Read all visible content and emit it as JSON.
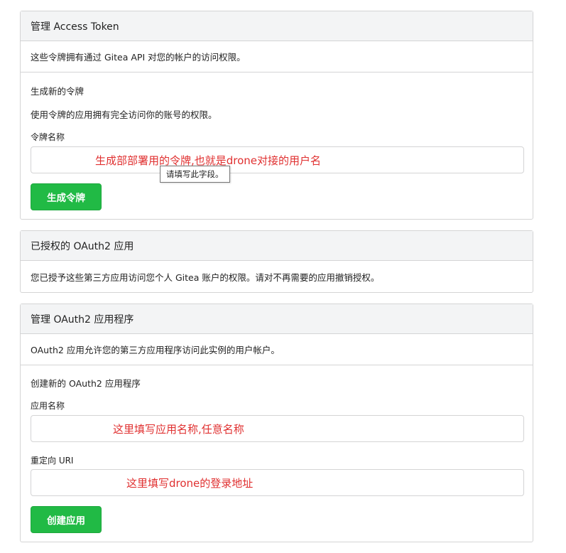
{
  "access_token": {
    "header": "管理 Access Token",
    "description": "这些令牌拥有通过 Gitea API 对您的帐户的访问权限。",
    "generate_title": "生成新的令牌",
    "generate_desc": "使用令牌的应用拥有完全访问你的账号的权限。",
    "name_label": "令牌名称",
    "name_value": "",
    "name_annotation": "生成部部署用的令牌,也就是drone对接的用户名",
    "validation_tooltip": "请填写此字段。",
    "generate_button": "生成令牌"
  },
  "authorized_oauth2": {
    "header": "已授权的 OAuth2 应用",
    "description": "您已授予这些第三方应用访问您个人 Gitea 账户的权限。请对不再需要的应用撤销授权。"
  },
  "manage_oauth2": {
    "header": "管理 OAuth2 应用程序",
    "description": "OAuth2 应用允许您的第三方应用程序访问此实例的用户帐户。",
    "create_title": "创建新的 OAuth2 应用程序",
    "app_name_label": "应用名称",
    "app_name_value": "",
    "app_name_annotation": "这里填写应用名称,任意名称",
    "redirect_label": "重定向 URI",
    "redirect_value": "",
    "redirect_annotation": "这里填写drone的登录地址",
    "create_button": "创建应用"
  },
  "colors": {
    "primary_button": "#21ba45",
    "annotation": "#e03030",
    "panel_header_bg": "#f3f4f5",
    "border": "#d4d4d5"
  }
}
